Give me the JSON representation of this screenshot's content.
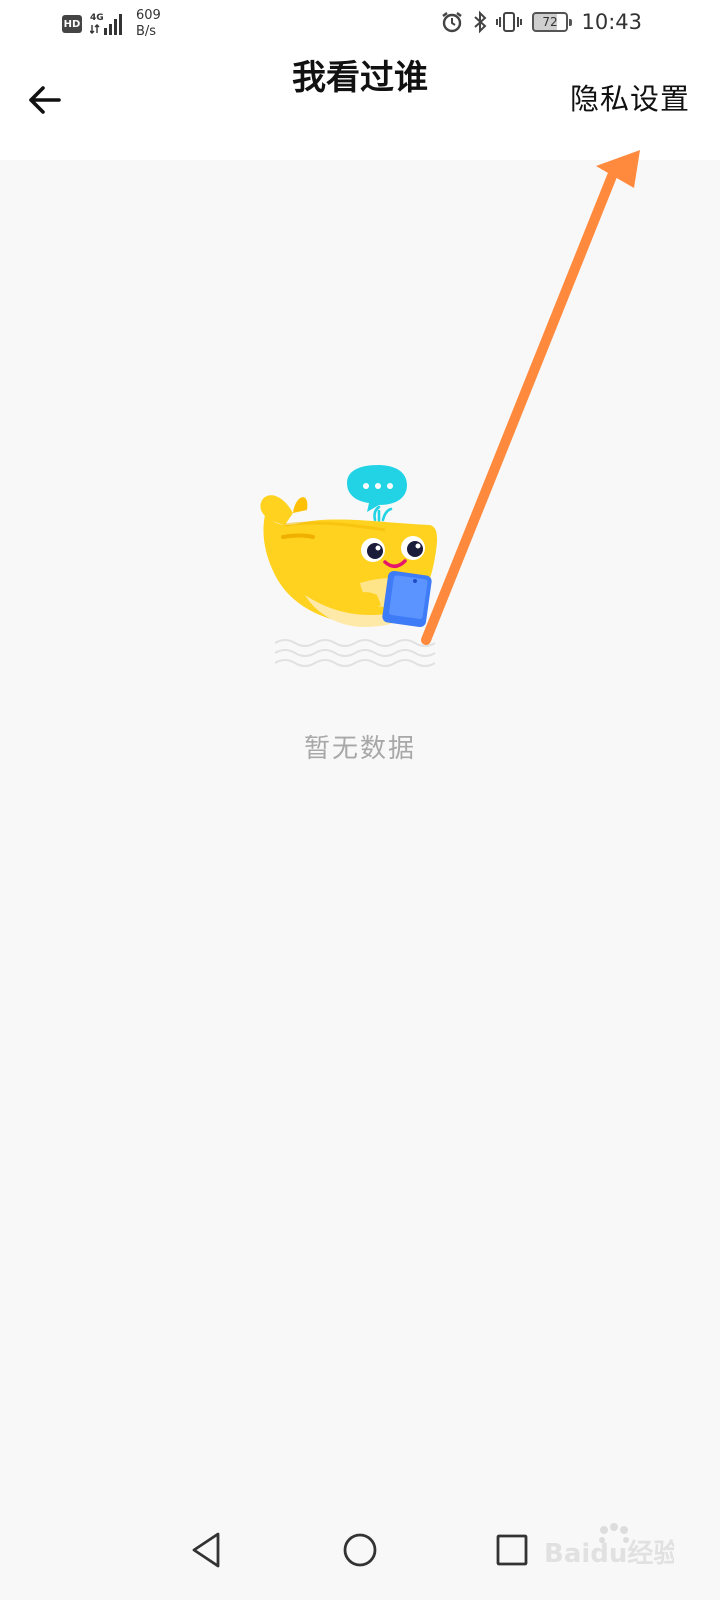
{
  "status_bar": {
    "hd_label": "HD",
    "network_type": "4G",
    "speed_value": "609",
    "speed_unit": "B/s",
    "battery_level": "72",
    "time": "10:43"
  },
  "header": {
    "title": "我看过谁",
    "privacy_link": "隐私设置"
  },
  "content": {
    "empty_text": "暂无数据"
  },
  "annotation": {
    "arrow_color": "#FF8A3D"
  },
  "colors": {
    "mascot_yellow": "#FFD21F",
    "bubble_cyan": "#22D3E6",
    "phone_blue": "#3E7BF6"
  },
  "watermark": {
    "text": "Baidu经验"
  },
  "icons": {
    "back": "arrow-left-icon",
    "nav_back": "triangle-back-icon",
    "nav_home": "circle-home-icon",
    "nav_recent": "square-recent-icon"
  }
}
